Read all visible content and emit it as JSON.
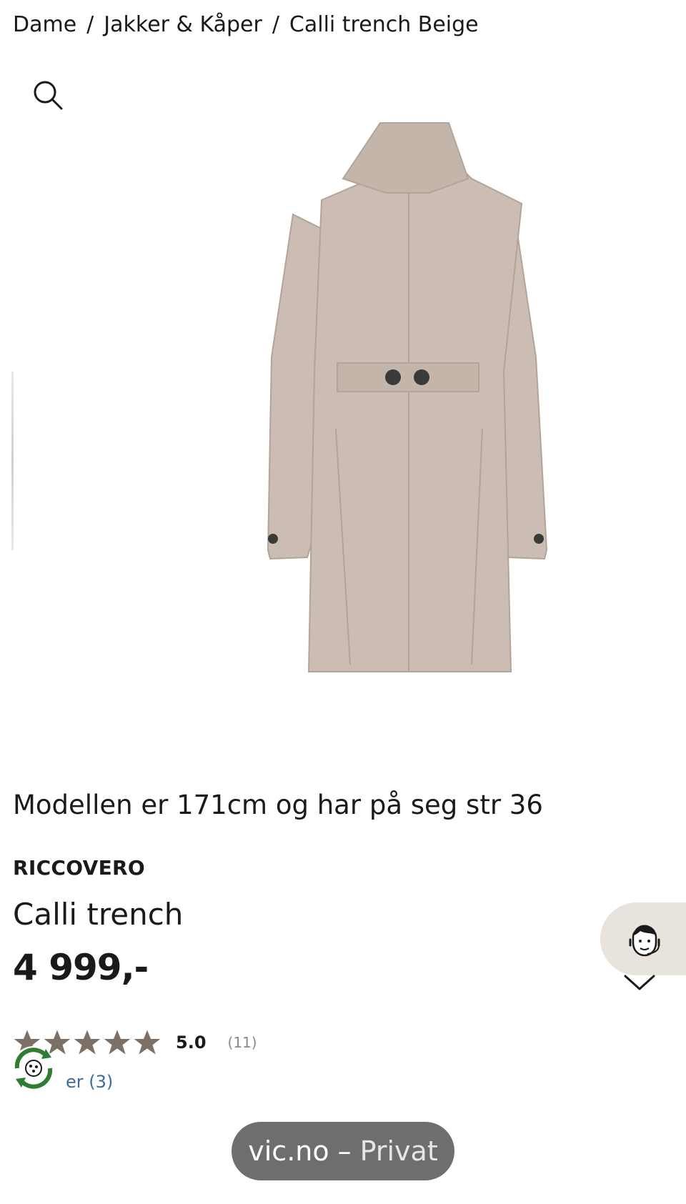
{
  "breadcrumb": {
    "items": [
      "Dame",
      "Jakker & Kåper",
      "Calli trench Beige"
    ],
    "separator": "/"
  },
  "product": {
    "model_note": "Modellen er 171cm og har på seg str 36",
    "brand": "RICCOVERO",
    "name": "Calli trench",
    "price": "4 999,-",
    "rating": {
      "score": "5.0",
      "count": "(11)",
      "stars_filled": 5,
      "stars_total": 5
    },
    "reviews_link": "er (3)",
    "image_color": "#cbbdb3"
  },
  "browser": {
    "url": "vic.no",
    "dash": "–",
    "mode": "Privat"
  },
  "colors": {
    "star": "#7d7067",
    "eco_green": "#2e7d32",
    "support_bg": "#e8e3dc",
    "link": "#3a6d9c"
  },
  "icons": [
    "search-icon",
    "support-agent-icon",
    "chevron-down-icon",
    "eco-recycle-icon",
    "star-icon"
  ]
}
